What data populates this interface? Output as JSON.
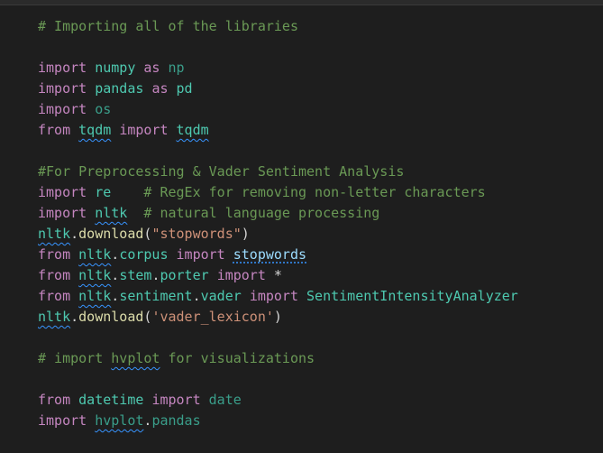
{
  "editor": {
    "lines": [
      {
        "comment": "# Importing all of the libraries"
      },
      {},
      {
        "kw1": "import",
        "mod": "numpy",
        "kw2": "as",
        "alias": "np"
      },
      {
        "kw1": "import",
        "mod": "pandas",
        "kw2": "as",
        "alias": "pd"
      },
      {
        "kw1": "import",
        "mod": "os"
      },
      {
        "kw1": "from",
        "mod": "tqdm",
        "kw2": "import",
        "alias": "tqdm"
      },
      {},
      {
        "comment": "#For Preprocessing & Vader Sentiment Analysis"
      },
      {
        "kw1": "import",
        "mod": "re",
        "comment": "# RegEx for removing non-letter characters"
      },
      {
        "kw1": "import",
        "mod": "nltk",
        "comment": "# natural language processing"
      },
      {
        "obj": "nltk",
        "fn": "download",
        "arg": "\"stopwords\""
      },
      {
        "kw1": "from",
        "mod": "nltk",
        "sub": "corpus",
        "kw2": "import",
        "name": "stopwords"
      },
      {
        "kw1": "from",
        "mod": "nltk",
        "sub": "stem",
        "sub2": "porter",
        "kw2": "import",
        "name": "*"
      },
      {
        "kw1": "from",
        "mod": "nltk",
        "sub": "sentiment",
        "sub2": "vader",
        "kw2": "import",
        "name": "SentimentIntensityAnalyzer"
      },
      {
        "obj": "nltk",
        "fn": "download",
        "arg": "'vader_lexicon'"
      },
      {},
      {
        "comment": "# import hvplot for visualizations",
        "squig": "hvplot"
      },
      {},
      {
        "kw1": "from",
        "mod": "datetime",
        "kw2": "import",
        "name": "date"
      },
      {
        "kw1": "import",
        "mod": "hvplot",
        "sub": "pandas"
      }
    ]
  },
  "punct": {
    "dot": ".",
    "lparen": "(",
    "rparen": ")",
    "star": "*"
  }
}
